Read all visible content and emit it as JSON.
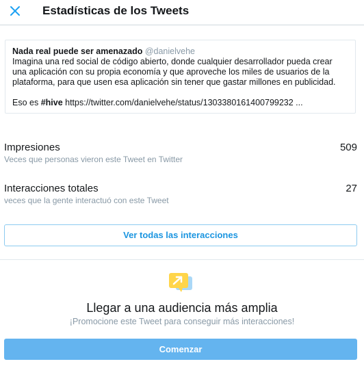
{
  "header": {
    "title": "Estadísticas de los Tweets",
    "close_icon": "close-icon"
  },
  "tweet": {
    "author": "Nada real puede ser amenazado",
    "handle": "@danielvehe",
    "lines": [
      "Imagina una red social de código abierto, donde cualquier desarrollador pueda crear",
      "una aplicación con su propia economía y que aproveche los miles de usuarios de la",
      "plataforma, para que usen esa aplicación sin tener que gastar millones en publicidad."
    ],
    "last_prefix": "Eso es ",
    "hashtag": "#hive",
    "link": " https://twitter.com/danielvehe/status/1303380161400799232 ..."
  },
  "stats": {
    "impressions": {
      "label": "Impresiones",
      "sub": "Veces que personas vieron este Tweet en Twitter",
      "value": "509"
    },
    "engagements": {
      "label": "Interacciones totales",
      "sub": "veces que la gente interactuó con este Tweet",
      "value": "27"
    }
  },
  "actions": {
    "view_all": "Ver todas las interacciones"
  },
  "promo": {
    "icon": "promote-arrow-icon",
    "title": "Llegar a una audiencia más amplia",
    "subtitle": "¡Promocione este Tweet para conseguir más interacciones!",
    "button": "Comenzar"
  },
  "colors": {
    "accent": "#1b95e0",
    "button_fill": "#64b4ef",
    "promo_yellow": "#ffd54a"
  }
}
